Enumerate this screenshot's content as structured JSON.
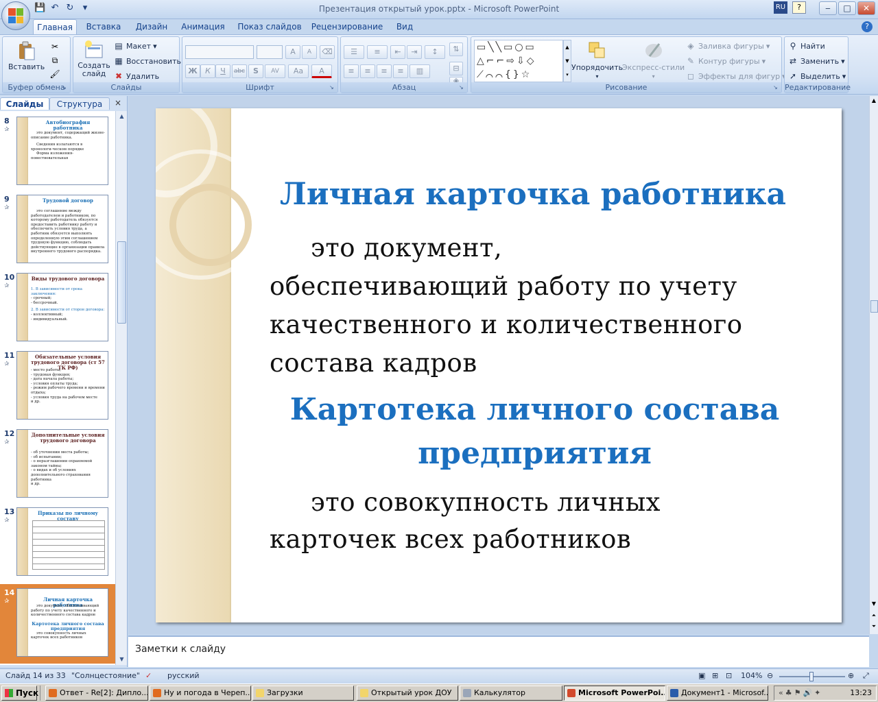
{
  "window": {
    "title": "Презентация открытый урок.pptx - Microsoft PowerPoint",
    "lang_indicator": "RU",
    "help_glyph": "?",
    "min": "‒",
    "max": "□",
    "close": "✕"
  },
  "ribbon_tabs": [
    "Главная",
    "Вставка",
    "Дизайн",
    "Анимация",
    "Показ слайдов",
    "Рецензирование",
    "Вид"
  ],
  "ribbon": {
    "clipboard": {
      "label": "Буфер обмена",
      "paste": "Вставить"
    },
    "slides": {
      "label": "Слайды",
      "new_slide": "Создать слайд",
      "layout": "Макет",
      "reset": "Восстановить",
      "delete": "Удалить"
    },
    "font": {
      "label": "Шрифт",
      "bold": "Ж",
      "italic": "К",
      "underline": "Ч",
      "strike": "abc",
      "shadow": "S",
      "spacing": "AV",
      "case": "Aa",
      "grow": "A",
      "shrink": "A"
    },
    "paragraph": {
      "label": "Абзац"
    },
    "drawing": {
      "label": "Рисование",
      "arrange": "Упорядочить",
      "quick_styles": "Экспресс-стили",
      "fill": "Заливка фигуры",
      "outline": "Контур фигуры",
      "effects": "Эффекты для фигур"
    },
    "editing": {
      "label": "Редактирование",
      "find": "Найти",
      "replace": "Заменить",
      "select": "Выделить"
    }
  },
  "pane_tabs": {
    "slides": "Слайды",
    "outline": "Структура",
    "close": "×"
  },
  "thumbnails": [
    {
      "num": "8",
      "title": "Автобиография работника",
      "lines": [
        "это документ, содержащий жизне-описание работника.",
        "Сведения излагаются в хронологи-ческом порядке",
        "Форма изложения- повествовательная"
      ]
    },
    {
      "num": "9",
      "title": "Трудовой договор",
      "lines": [
        "это соглашение между работодателем и работником, по которому работодатель обязуется предоставить работнику работу и обеспечить условия труда, а работник обязуется выполнять определенную этим соглашением трудовую функцию, соблюдать действующие в организации правила внутреннего трудового распорядка."
      ]
    },
    {
      "num": "10",
      "title": "Виды трудового договора",
      "lines": [
        "1. В зависимости от срока заключения:",
        "- срочный;",
        "- бессрочный.",
        "2. В зависимости от сторон договора:",
        "- коллективный;",
        "- индивидуальный."
      ]
    },
    {
      "num": "11",
      "title": "Обязательные условия трудового договора (ст 57 ТК РФ)",
      "lines": [
        "- место работы;",
        "- трудовая функция;",
        "- дата начала работы;",
        "- условия оплаты труда;",
        "- режим рабочего времени и времени отдыха;",
        "- условия труда на рабочем месте",
        "и  др."
      ]
    },
    {
      "num": "12",
      "title": "Дополнительные условия трудового договора",
      "lines": [
        "- об уточнении места работы;",
        "- об испытании;",
        "- о неразглашении охраняемой законом тайны;",
        "- о видах и об условиях дополнительного страхования работника",
        "и др."
      ]
    },
    {
      "num": "13",
      "title": "Приказы по личному составу",
      "lines": []
    },
    {
      "num": "14",
      "title": "Личная карточка работника",
      "lines": [
        "это документ, обеспечивающий работу по учету качественного и количественного состава кадров",
        "Картотека личного состава предприятия",
        "это совокупность личных карточек всех работников"
      ]
    }
  ],
  "slide": {
    "title1": "Личная карточка работника",
    "body1": "это документ, обеспечивающий работу по учету качественного и количественного состава кадров",
    "title2": "Картотека личного состава предприятия",
    "body2": "это совокупность личных карточек всех работников"
  },
  "notes_placeholder": "Заметки к слайду",
  "status": {
    "slide": "Слайд 14 из 33",
    "theme": "\"Солнцестояние\"",
    "language": "русский",
    "zoom": "104%"
  },
  "taskbar": {
    "start": "Пуск",
    "items": [
      "Ответ - Re[2]: Дипло...",
      "Ну и погода в Череп...",
      "Загрузки",
      "Открытый урок ДОУ",
      "Калькулятор",
      "Microsoft PowerPoi...",
      "Документ1 - Microsof..."
    ],
    "clock": "13:23"
  }
}
